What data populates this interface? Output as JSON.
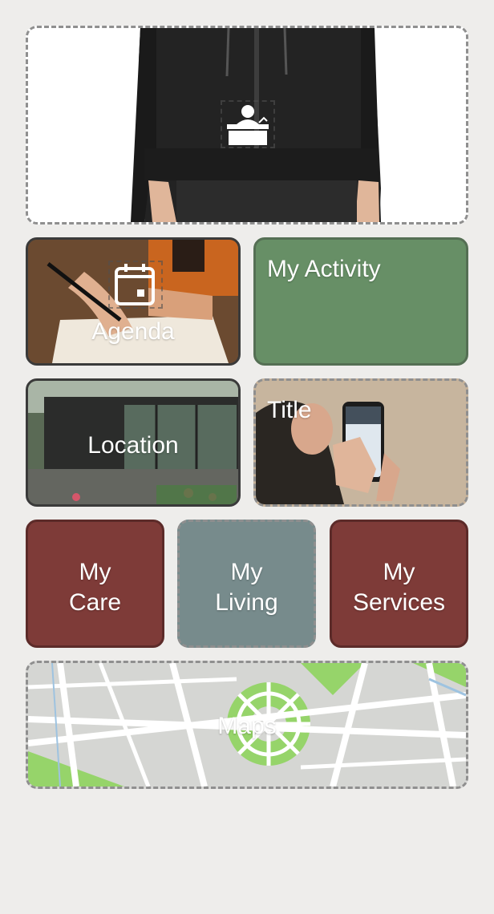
{
  "tiles": {
    "hero": {
      "icon": "reception-desk-icon"
    },
    "agenda": {
      "label": "Agenda",
      "icon": "calendar-icon"
    },
    "activity": {
      "label": "My Activity"
    },
    "location": {
      "label": "Location"
    },
    "title": {
      "label": "Title"
    },
    "care": {
      "label": "My\nCare"
    },
    "living": {
      "label": "My\nLiving"
    },
    "services": {
      "label": "My\nServices"
    },
    "maps": {
      "label": "Maps"
    }
  },
  "colors": {
    "background": "#eeedeb",
    "activity": "#678f66",
    "care": "#7e3b38",
    "living": "#778b8c",
    "services": "#7e3b38"
  }
}
